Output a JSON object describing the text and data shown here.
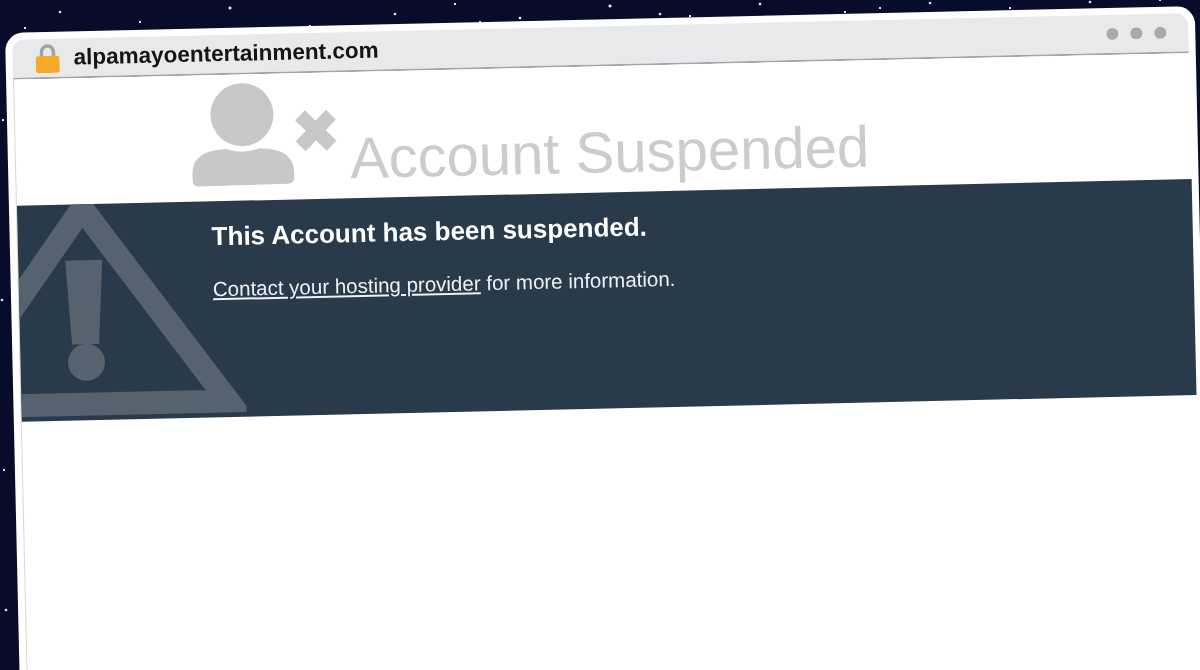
{
  "browser": {
    "address": "alpamayoentertainment.com"
  },
  "page": {
    "heading": "Account Suspended",
    "notice": {
      "title": "This Account has been suspended.",
      "link": "Contact your hosting provider",
      "text": "for more information."
    }
  }
}
